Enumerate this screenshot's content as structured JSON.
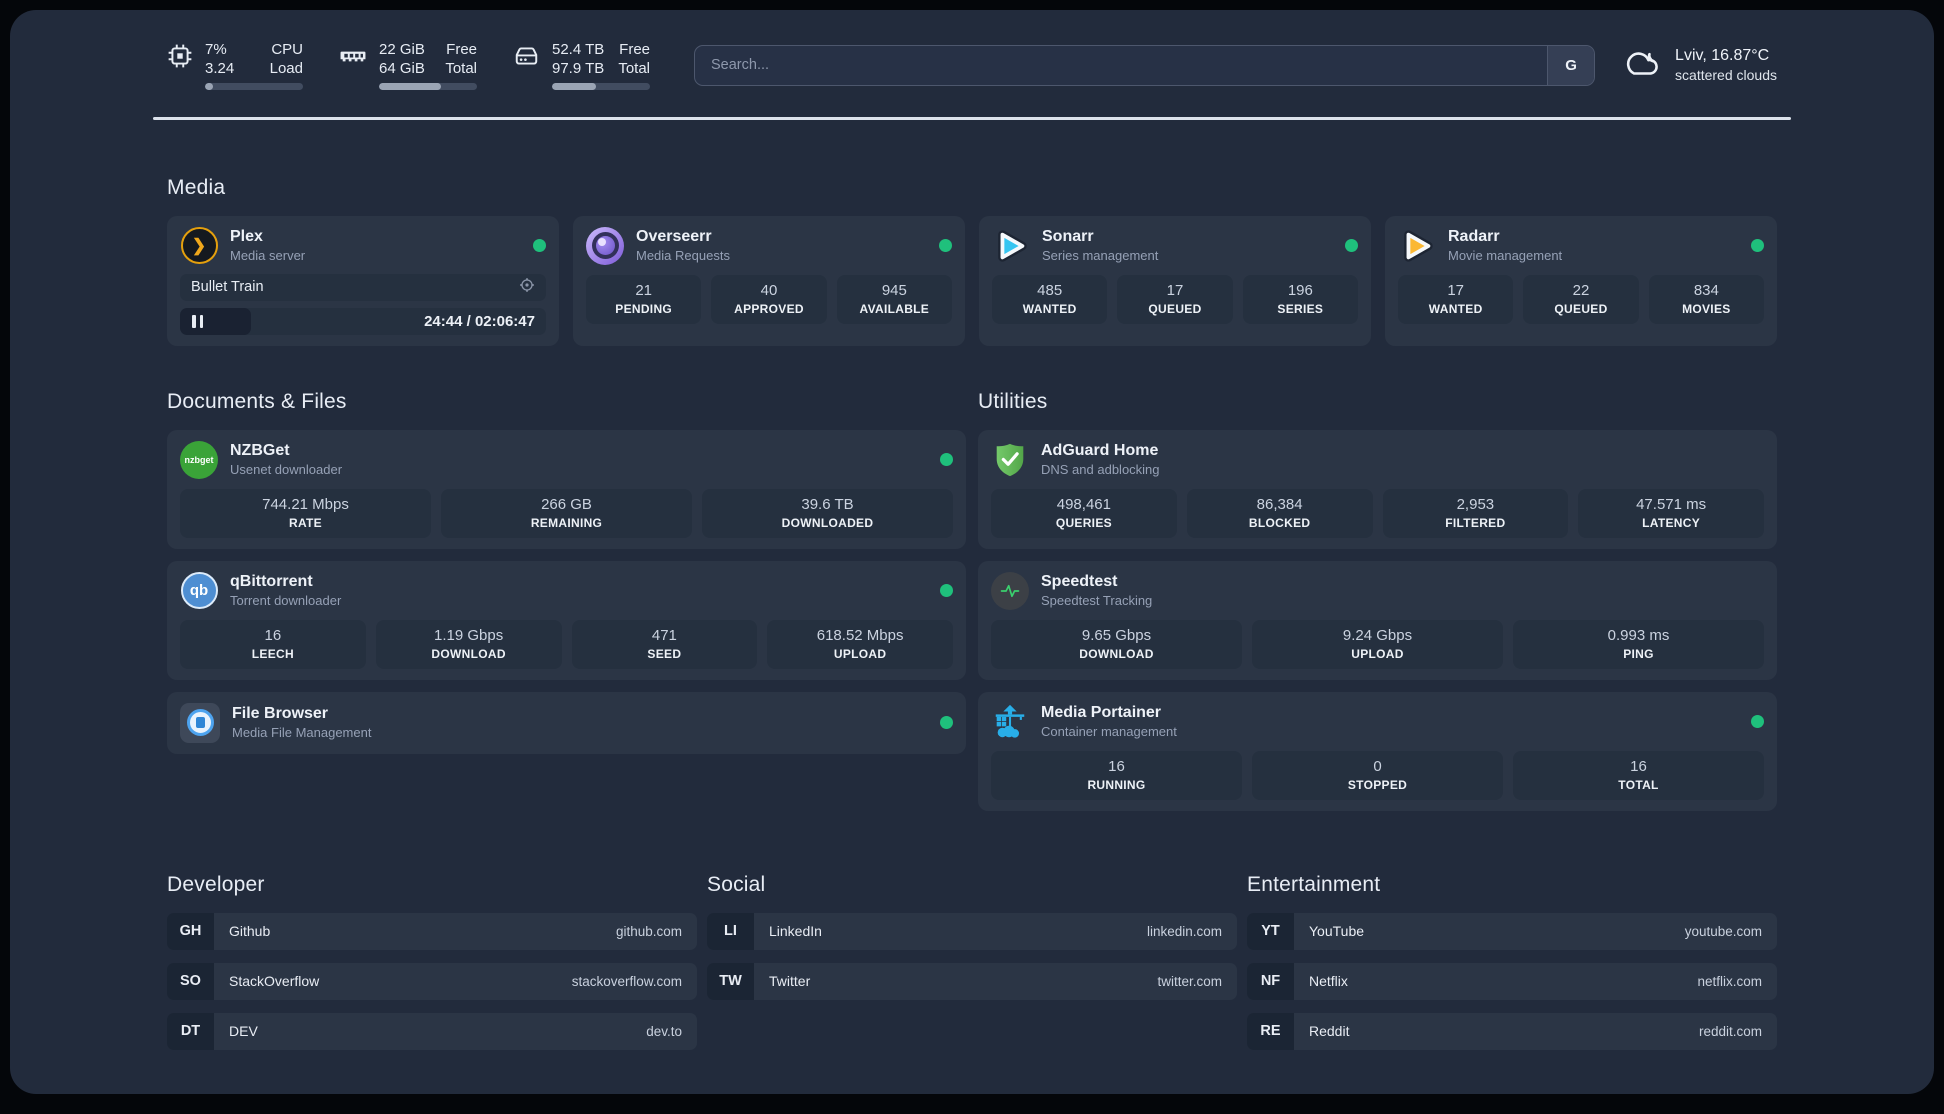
{
  "topbar": {
    "stats": [
      {
        "icon": "cpu-icon",
        "value1": "7%",
        "value2": "3.24",
        "label1": "CPU",
        "label2": "Load",
        "progress_percent": 8
      },
      {
        "icon": "ram-icon",
        "value1": "22 GiB",
        "value2": "64 GiB",
        "label1": "Free",
        "label2": "Total",
        "progress_percent": 63
      },
      {
        "icon": "disk-icon",
        "value1": "52.4 TB",
        "value2": "97.9 TB",
        "label1": "Free",
        "label2": "Total",
        "progress_percent": 45
      }
    ],
    "search": {
      "placeholder": "Search...",
      "button_label": "G"
    },
    "weather": {
      "icon": "cloud-icon",
      "location_temp": "Lviv, 16.87°C",
      "condition": "scattered clouds"
    }
  },
  "section_titles": {
    "media": "Media",
    "documents": "Documents & Files",
    "utilities": "Utilities",
    "developer": "Developer",
    "social": "Social",
    "entertainment": "Entertainment"
  },
  "apps": {
    "plex": {
      "title": "Plex",
      "subtitle": "Media server",
      "icon": "plex-icon",
      "online": true,
      "now_playing": "Bullet Train",
      "time": "24:44 / 02:06:47",
      "progress_percent": 19.5
    },
    "overseerr": {
      "title": "Overseerr",
      "subtitle": "Media Requests",
      "icon": "overseerr-icon",
      "online": true,
      "stats": [
        {
          "value": "21",
          "label": "PENDING"
        },
        {
          "value": "40",
          "label": "APPROVED"
        },
        {
          "value": "945",
          "label": "AVAILABLE"
        }
      ]
    },
    "sonarr": {
      "title": "Sonarr",
      "subtitle": "Series management",
      "icon": "sonarr-icon",
      "online": true,
      "stats": [
        {
          "value": "485",
          "label": "WANTED"
        },
        {
          "value": "17",
          "label": "QUEUED"
        },
        {
          "value": "196",
          "label": "SERIES"
        }
      ]
    },
    "radarr": {
      "title": "Radarr",
      "subtitle": "Movie management",
      "icon": "radarr-icon",
      "online": true,
      "stats": [
        {
          "value": "17",
          "label": "WANTED"
        },
        {
          "value": "22",
          "label": "QUEUED"
        },
        {
          "value": "834",
          "label": "MOVIES"
        }
      ]
    },
    "nzbget": {
      "title": "NZBGet",
      "subtitle": "Usenet downloader",
      "icon": "nzbget-icon",
      "icon_text": "nzbget",
      "online": true,
      "stats": [
        {
          "value": "744.21 Mbps",
          "label": "RATE"
        },
        {
          "value": "266 GB",
          "label": "REMAINING"
        },
        {
          "value": "39.6 TB",
          "label": "DOWNLOADED"
        }
      ]
    },
    "qbittorrent": {
      "title": "qBittorrent",
      "subtitle": "Torrent downloader",
      "icon": "qbittorrent-icon",
      "icon_text": "qb",
      "online": true,
      "stats": [
        {
          "value": "16",
          "label": "LEECH"
        },
        {
          "value": "1.19 Gbps",
          "label": "DOWNLOAD"
        },
        {
          "value": "471",
          "label": "SEED"
        },
        {
          "value": "618.52 Mbps",
          "label": "UPLOAD"
        }
      ]
    },
    "filebrowser": {
      "title": "File Browser",
      "subtitle": "Media File Management",
      "icon": "filebrowser-icon",
      "online": true
    },
    "adguard": {
      "title": "AdGuard Home",
      "subtitle": "DNS and adblocking",
      "icon": "adguard-shield-icon",
      "stats": [
        {
          "value": "498,461",
          "label": "QUERIES"
        },
        {
          "value": "86,384",
          "label": "BLOCKED"
        },
        {
          "value": "2,953",
          "label": "FILTERED"
        },
        {
          "value": "47.571 ms",
          "label": "LATENCY"
        }
      ]
    },
    "speedtest": {
      "title": "Speedtest",
      "subtitle": "Speedtest Tracking",
      "icon": "speedtest-pulse-icon",
      "stats": [
        {
          "value": "9.65 Gbps",
          "label": "DOWNLOAD"
        },
        {
          "value": "9.24 Gbps",
          "label": "UPLOAD"
        },
        {
          "value": "0.993 ms",
          "label": "PING"
        }
      ]
    },
    "portainer": {
      "title": "Media Portainer",
      "subtitle": "Container management",
      "icon": "portainer-icon",
      "online": true,
      "stats": [
        {
          "value": "16",
          "label": "RUNNING"
        },
        {
          "value": "0",
          "label": "STOPPED"
        },
        {
          "value": "16",
          "label": "TOTAL"
        }
      ]
    }
  },
  "links": {
    "developer": [
      {
        "abbr": "GH",
        "name": "Github",
        "domain": "github.com"
      },
      {
        "abbr": "SO",
        "name": "StackOverflow",
        "domain": "stackoverflow.com"
      },
      {
        "abbr": "DT",
        "name": "DEV",
        "domain": "dev.to"
      }
    ],
    "social": [
      {
        "abbr": "LI",
        "name": "LinkedIn",
        "domain": "linkedin.com"
      },
      {
        "abbr": "TW",
        "name": "Twitter",
        "domain": "twitter.com"
      }
    ],
    "entertainment": [
      {
        "abbr": "YT",
        "name": "YouTube",
        "domain": "youtube.com"
      },
      {
        "abbr": "NF",
        "name": "Netflix",
        "domain": "netflix.com"
      },
      {
        "abbr": "RE",
        "name": "Reddit",
        "domain": "reddit.com"
      }
    ]
  },
  "colors": {
    "status_online": "#1fc07c",
    "plex_gold": "#e5a00d",
    "sonarr_blue": "#35c5f1",
    "radarr_amber": "#fbb834",
    "adguard_green": "#63b858",
    "portainer_blue": "#28aee8",
    "page_bg": "#222b3c",
    "card_bg": "#2b3545"
  }
}
